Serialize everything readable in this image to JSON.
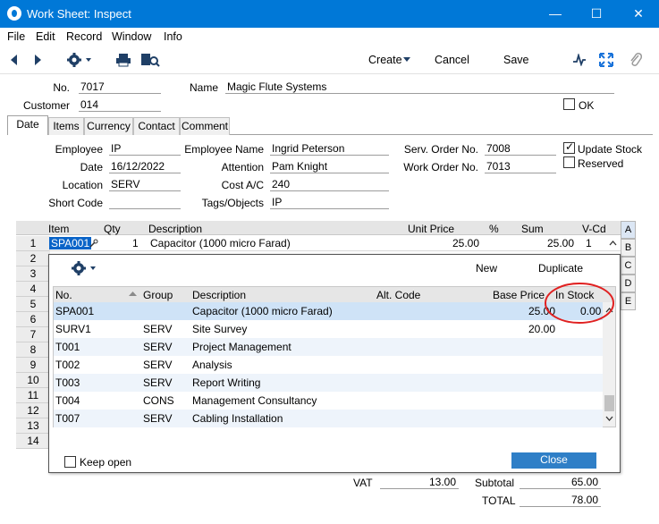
{
  "window": {
    "title": "Work Sheet: Inspect",
    "min": "—",
    "max": "☐",
    "close": "✕"
  },
  "menu": [
    "File",
    "Edit",
    "Record",
    "Window",
    "Info"
  ],
  "toolbar": {
    "create": "Create",
    "cancel": "Cancel",
    "save": "Save"
  },
  "header": {
    "no_label": "No.",
    "no_value": "7017",
    "name_label": "Name",
    "name_value": "Magic Flute Systems",
    "customer_label": "Customer",
    "customer_value": "014",
    "ok_label": "OK"
  },
  "tabs": [
    "Date",
    "Items",
    "Currency",
    "Contact",
    "Comment"
  ],
  "date_tab": {
    "employee_label": "Employee",
    "employee_value": "IP",
    "employee_name_label": "Employee Name",
    "employee_name_value": "Ingrid Peterson",
    "serv_order_label": "Serv. Order No.",
    "serv_order_value": "7008",
    "update_stock_label": "Update Stock",
    "date_label": "Date",
    "date_value": "16/12/2022",
    "attention_label": "Attention",
    "attention_value": "Pam Knight",
    "work_order_label": "Work Order No.",
    "work_order_value": "7013",
    "reserved_label": "Reserved",
    "location_label": "Location",
    "location_value": "SERV",
    "cost_label": "Cost A/C",
    "cost_value": "240",
    "short_code_label": "Short Code",
    "tags_label": "Tags/Objects",
    "tags_value": "IP"
  },
  "grid": {
    "headers": {
      "item": "Item",
      "qty": "Qty",
      "description": "Description",
      "unit_price": "Unit Price",
      "pct": "%",
      "sum": "Sum",
      "vcd": "V-Cd"
    },
    "rows": [
      "1",
      "2",
      "3",
      "4",
      "5",
      "6",
      "7",
      "8",
      "9",
      "10",
      "11",
      "12",
      "13",
      "14"
    ],
    "row1": {
      "item": "SPA001",
      "qty": "1",
      "description": "Capacitor (1000 micro Farad)",
      "unit_price": "25.00",
      "sum": "25.00",
      "vcd": "1"
    },
    "side_tabs": [
      "A",
      "B",
      "C",
      "D",
      "E"
    ]
  },
  "popup": {
    "new": "New",
    "duplicate": "Duplicate",
    "columns": {
      "no": "No.",
      "group": "Group",
      "description": "Description",
      "alt_code": "Alt. Code",
      "base_price": "Base Price",
      "in_stock": "In Stock"
    },
    "rows": [
      {
        "no": "SPA001",
        "group": "",
        "description": "Capacitor (1000 micro Farad)",
        "base_price": "25.00",
        "in_stock": "0.00"
      },
      {
        "no": "SURV1",
        "group": "SERV",
        "description": "Site Survey",
        "base_price": "20.00",
        "in_stock": ""
      },
      {
        "no": "T001",
        "group": "SERV",
        "description": "Project Management",
        "base_price": "",
        "in_stock": ""
      },
      {
        "no": "T002",
        "group": "SERV",
        "description": "Analysis",
        "base_price": "",
        "in_stock": ""
      },
      {
        "no": "T003",
        "group": "SERV",
        "description": "Report Writing",
        "base_price": "",
        "in_stock": ""
      },
      {
        "no": "T004",
        "group": "CONS",
        "description": "Management Consultancy",
        "base_price": "",
        "in_stock": ""
      },
      {
        "no": "T007",
        "group": "SERV",
        "description": "Cabling Installation",
        "base_price": "",
        "in_stock": ""
      }
    ],
    "keep_open": "Keep open",
    "close": "Close"
  },
  "totals": {
    "vat_label": "VAT",
    "vat_value": "13.00",
    "subtotal_label": "Subtotal",
    "subtotal_value": "65.00",
    "total_label": "TOTAL",
    "total_value": "78.00"
  },
  "colors": {
    "titlebar": "#0078d7",
    "selection": "#cfe3f7",
    "highlight_circle": "#e02020",
    "close_button": "#2f7fc7"
  }
}
